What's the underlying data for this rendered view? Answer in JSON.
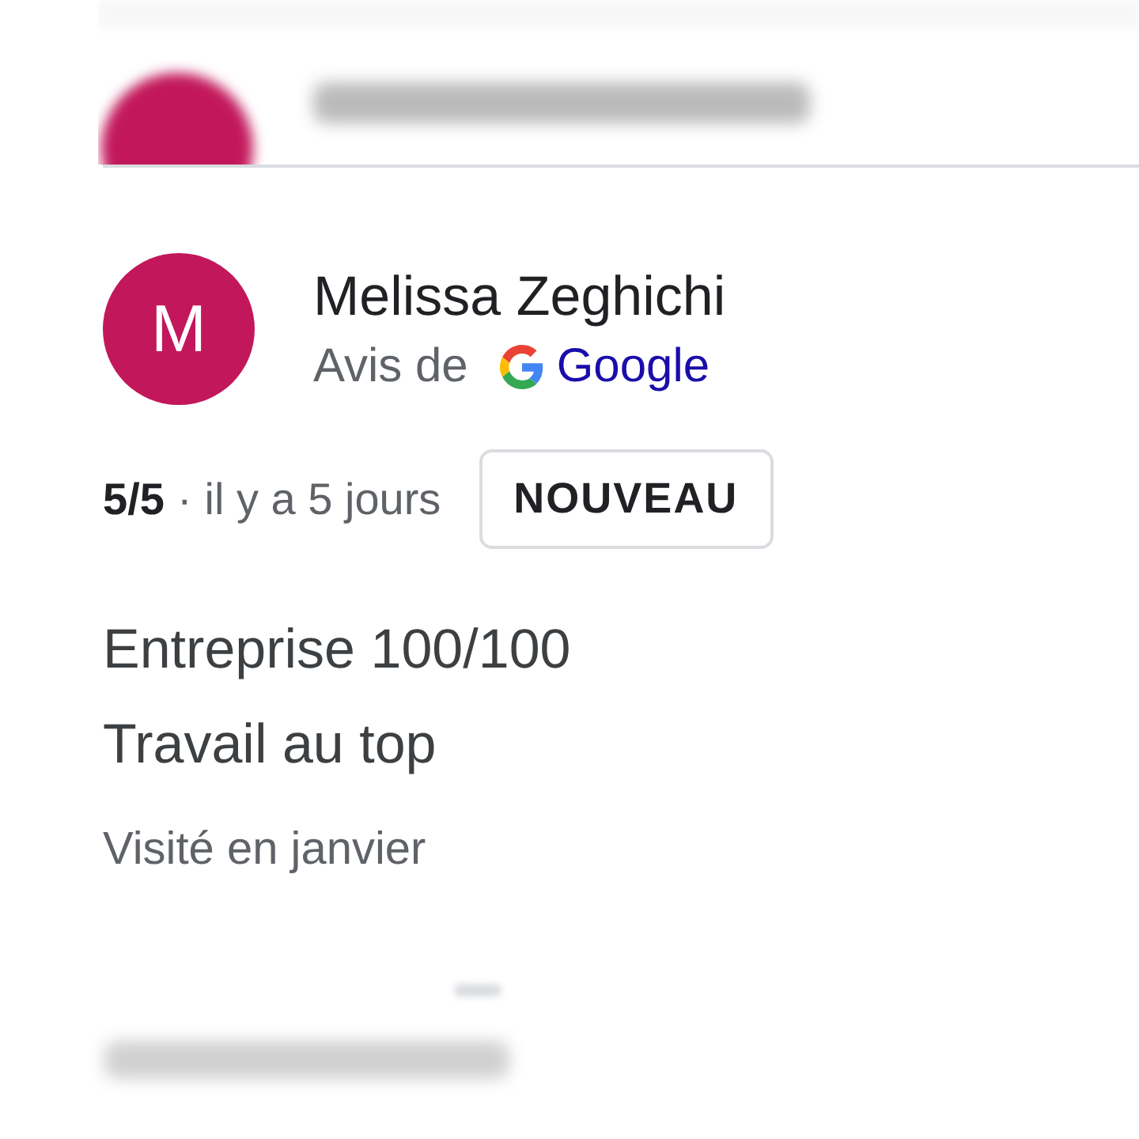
{
  "review": {
    "avatar_letter": "M",
    "author": "Melissa Zeghichi",
    "source_prefix": "Avis de",
    "source_name": "Google",
    "rating": "5/5",
    "separator": "·",
    "time": "il y a 5 jours",
    "badge": "NOUVEAU",
    "text_lines": [
      "Entreprise 100/100",
      "Travail au top"
    ],
    "visited": "Visité en janvier"
  }
}
